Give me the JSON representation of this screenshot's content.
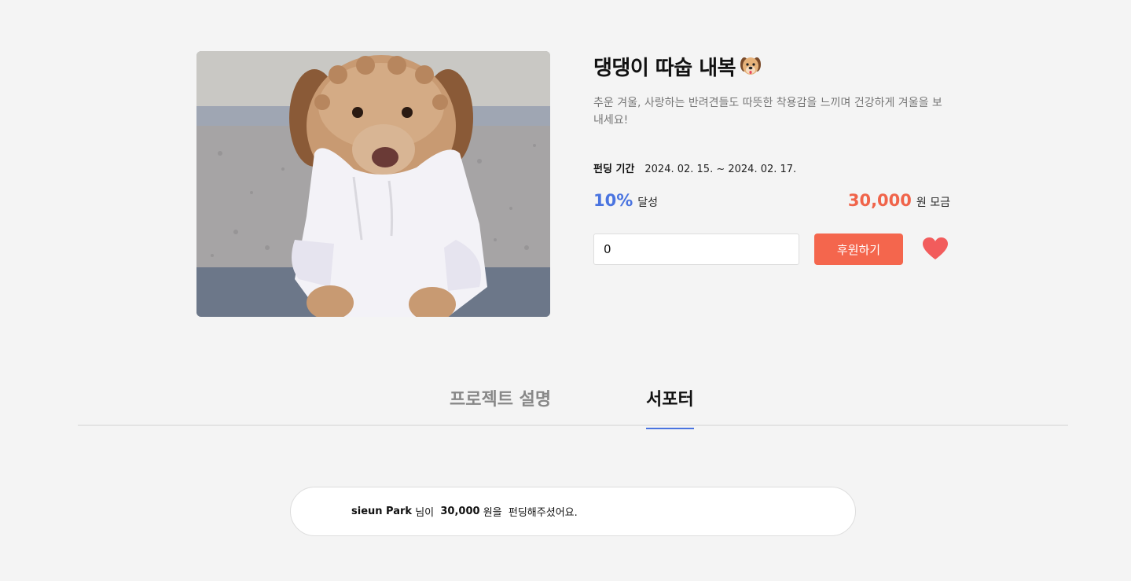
{
  "product": {
    "title": "댕댕이 따숩 내복",
    "description": "추운 겨울, 사랑하는 반려견들도 따뜻한 착용감을 느끼며 건강하게 겨울을 보내세요!",
    "period_label": "펀딩 기간",
    "period_value": "2024. 02. 15. ~ 2024. 02. 17.",
    "rate": "10%",
    "rate_label": "달성",
    "amount": "30,000",
    "amount_unit": "원 모금",
    "input_value": "0",
    "fund_button": "후원하기",
    "heart_color": "#f25c5c",
    "rate_color": "#4a74e0",
    "amount_color": "#f0644a"
  },
  "tabs": [
    {
      "label": "프로젝트 설명",
      "active": false
    },
    {
      "label": "서포터",
      "active": true
    }
  ],
  "supporters": [
    {
      "name": "sieun Park",
      "suffix": "님이",
      "amount": "30,000",
      "amount_unit": "원을",
      "message": "펀딩해주셨어요."
    }
  ]
}
